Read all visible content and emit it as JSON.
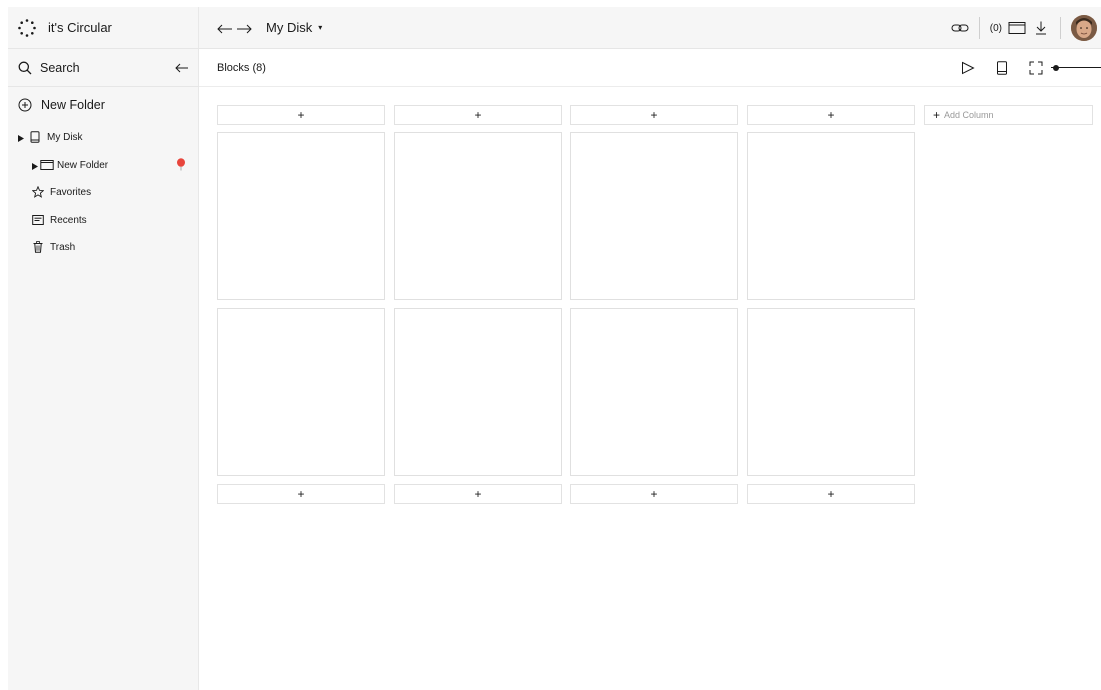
{
  "app": {
    "title": "it's Circular"
  },
  "sidebar": {
    "search_label": "Search",
    "new_folder_label": "New Folder",
    "tree": [
      {
        "label": "My Disk",
        "icon": "tablet-icon",
        "expandable": true
      },
      {
        "label": "New Folder",
        "icon": "folder-window-icon",
        "expandable": true,
        "badge_icon": "balloon-icon"
      },
      {
        "label": "Favorites",
        "icon": "star-icon"
      },
      {
        "label": "Recents",
        "icon": "recents-icon"
      },
      {
        "label": "Trash",
        "icon": "trash-icon"
      }
    ]
  },
  "header": {
    "title": "My Disk",
    "title_caret": "▾",
    "count": "(0)"
  },
  "subheader": {
    "blocks_label": "Blocks (8)"
  },
  "board": {
    "add_symbol": "+",
    "add_column_plus": "+",
    "add_column_label": "Add Column",
    "block_count": 8,
    "column_count": 4
  },
  "colors": {
    "sidebar_bg": "#f6f6f6",
    "border": "#e2e2e2",
    "text": "#1a1a1a",
    "balloon": "#e8453c"
  }
}
